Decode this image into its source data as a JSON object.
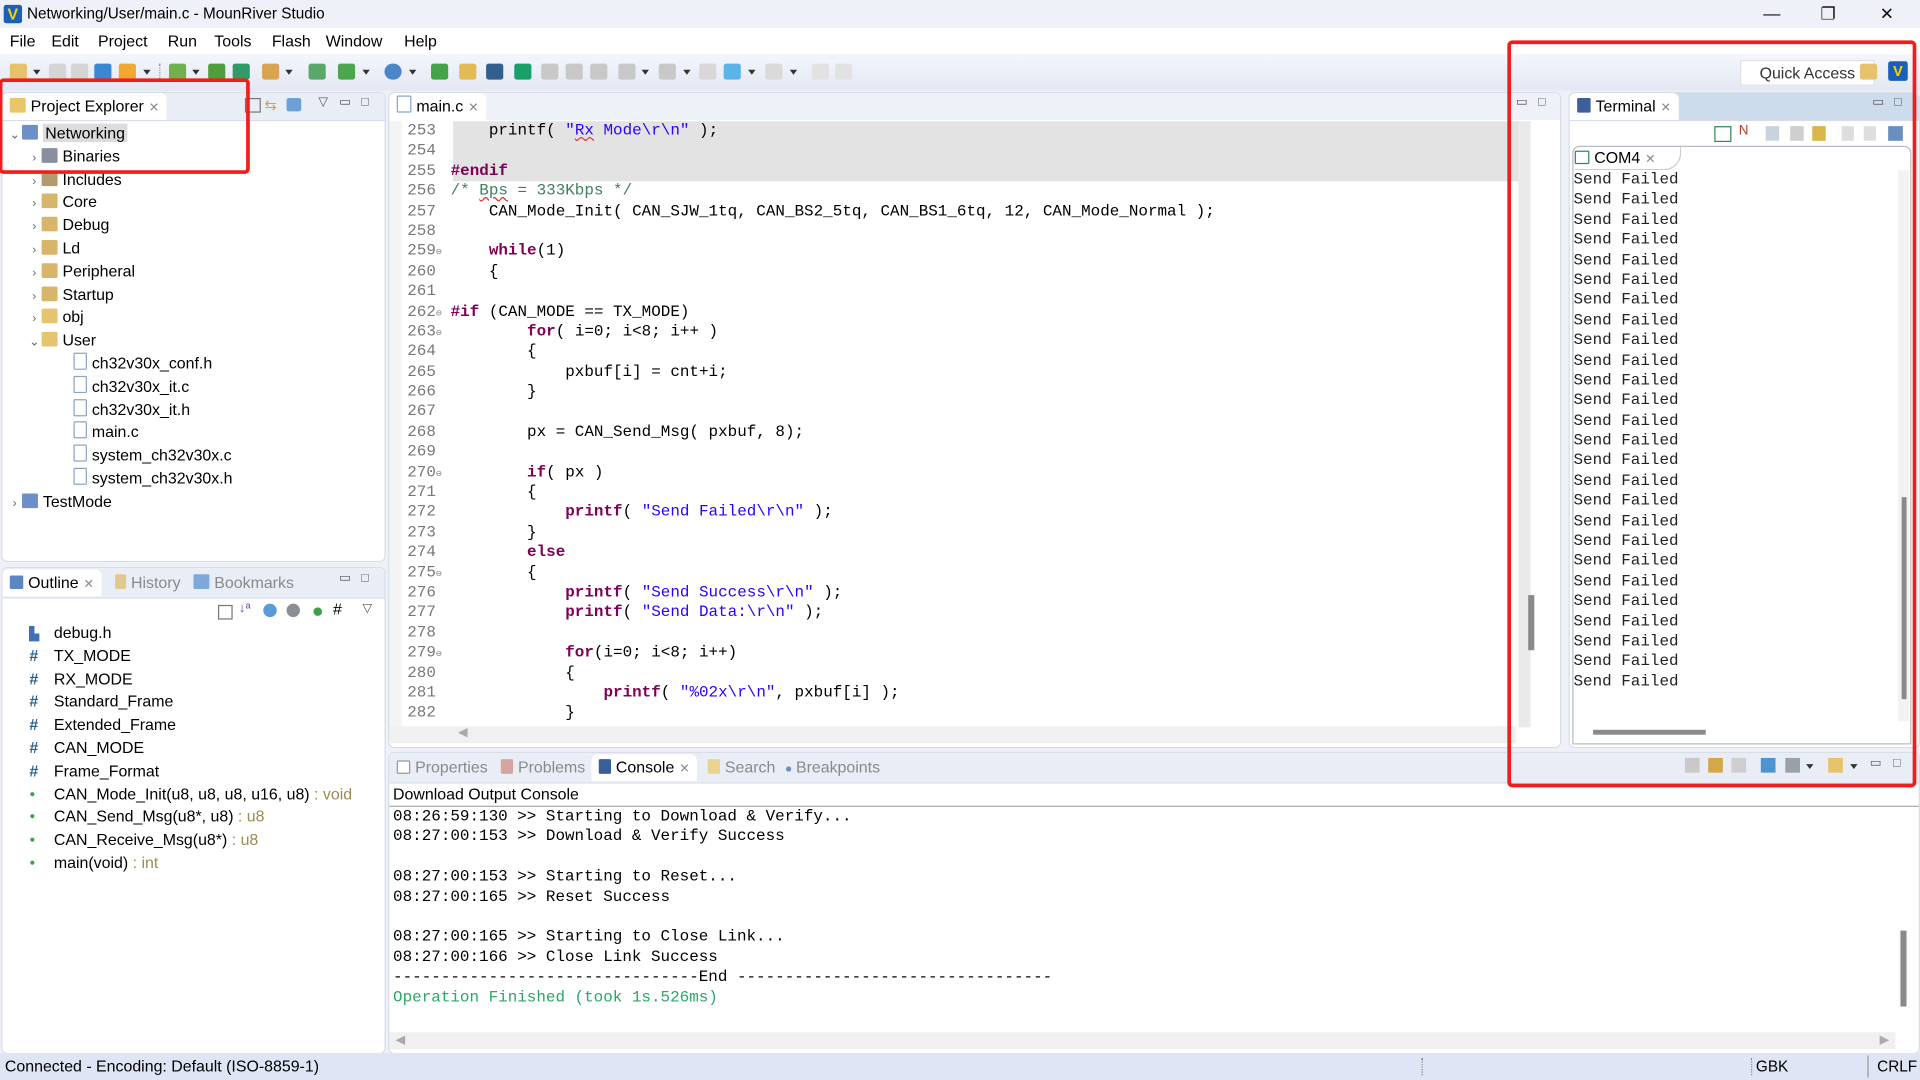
{
  "window": {
    "title": "Networking/User/main.c - MounRiver Studio",
    "controls": {
      "minimize": "—",
      "restore": "❐",
      "close": "✕"
    }
  },
  "menu": [
    "File",
    "Edit",
    "Project",
    "Run",
    "Tools",
    "Flash",
    "Window",
    "Help"
  ],
  "toolbar": {
    "quick_access": "Quick Access"
  },
  "project_explorer": {
    "tab_label": "Project Explorer",
    "tree": [
      {
        "label": "Networking",
        "level": 0,
        "expanded": true,
        "icon": "c-project-icon",
        "selected": true
      },
      {
        "label": "Binaries",
        "level": 1,
        "expanded": false,
        "icon": "binaries-icon"
      },
      {
        "label": "Includes",
        "level": 1,
        "expanded": false,
        "icon": "includes-icon"
      },
      {
        "label": "Core",
        "level": 1,
        "expanded": false,
        "icon": "source-folder-icon"
      },
      {
        "label": "Debug",
        "level": 1,
        "expanded": false,
        "icon": "source-folder-icon"
      },
      {
        "label": "Ld",
        "level": 1,
        "expanded": false,
        "icon": "source-folder-icon"
      },
      {
        "label": "Peripheral",
        "level": 1,
        "expanded": false,
        "icon": "source-folder-icon"
      },
      {
        "label": "Startup",
        "level": 1,
        "expanded": false,
        "icon": "source-folder-icon"
      },
      {
        "label": "obj",
        "level": 1,
        "expanded": false,
        "icon": "folder-icon"
      },
      {
        "label": "User",
        "level": 1,
        "expanded": true,
        "icon": "folder-icon"
      },
      {
        "label": "ch32v30x_conf.h",
        "level": 2,
        "icon": "header-file-icon"
      },
      {
        "label": "ch32v30x_it.c",
        "level": 2,
        "icon": "c-file-icon"
      },
      {
        "label": "ch32v30x_it.h",
        "level": 2,
        "icon": "header-file-icon"
      },
      {
        "label": "main.c",
        "level": 2,
        "icon": "c-file-icon"
      },
      {
        "label": "system_ch32v30x.c",
        "level": 2,
        "icon": "c-file-icon"
      },
      {
        "label": "system_ch32v30x.h",
        "level": 2,
        "icon": "header-file-icon"
      },
      {
        "label": "TestMode",
        "level": 0,
        "expanded": false,
        "icon": "c-project-icon"
      }
    ]
  },
  "outline": {
    "tabs": [
      {
        "label": "Outline",
        "active": true
      },
      {
        "label": "History",
        "active": false
      },
      {
        "label": "Bookmarks",
        "active": false
      }
    ],
    "items": [
      {
        "kind": "include",
        "name": "debug.h",
        "type": ""
      },
      {
        "kind": "macro",
        "name": "TX_MODE",
        "type": ""
      },
      {
        "kind": "macro",
        "name": "RX_MODE",
        "type": ""
      },
      {
        "kind": "macro",
        "name": "Standard_Frame",
        "type": ""
      },
      {
        "kind": "macro",
        "name": "Extended_Frame",
        "type": ""
      },
      {
        "kind": "macro",
        "name": "CAN_MODE",
        "type": ""
      },
      {
        "kind": "macro",
        "name": "Frame_Format",
        "type": ""
      },
      {
        "kind": "function",
        "name": "CAN_Mode_Init(u8, u8, u8, u16, u8)",
        "type": " : void"
      },
      {
        "kind": "function",
        "name": "CAN_Send_Msg(u8*, u8)",
        "type": " : u8"
      },
      {
        "kind": "function",
        "name": "CAN_Receive_Msg(u8*)",
        "type": " : u8"
      },
      {
        "kind": "function",
        "name": "main(void)",
        "type": " : int"
      }
    ]
  },
  "editor": {
    "tab_label": "main.c",
    "lines": [
      {
        "n": "253",
        "fold": "",
        "hl": true,
        "html": "    printf( <span class='str'>\"<span class='sq'>Rx</span> Mode\\r\\n\"</span> );"
      },
      {
        "n": "254",
        "fold": "",
        "hl": true,
        "html": ""
      },
      {
        "n": "255",
        "fold": "",
        "hl": true,
        "html": "<span class='kw'>#endif</span>"
      },
      {
        "n": "256",
        "fold": "",
        "hl": false,
        "html": "<span class='cm'>/* <span class='sq'>Bps</span> = 333Kbps */</span>"
      },
      {
        "n": "257",
        "fold": "",
        "hl": false,
        "html": "    CAN_Mode_Init( CAN_SJW_1tq, CAN_BS2_5tq, CAN_BS1_6tq, 12, CAN_Mode_Normal );"
      },
      {
        "n": "258",
        "fold": "",
        "hl": false,
        "html": ""
      },
      {
        "n": "259",
        "fold": "⊖",
        "hl": false,
        "html": "    <span class='kw'>while</span>(1)"
      },
      {
        "n": "260",
        "fold": "",
        "hl": false,
        "html": "    {"
      },
      {
        "n": "261",
        "fold": "",
        "hl": false,
        "html": ""
      },
      {
        "n": "262",
        "fold": "⊖",
        "hl": false,
        "html": "<span class='kw'>#if</span> (CAN_MODE == TX_MODE)"
      },
      {
        "n": "263",
        "fold": "⊖",
        "hl": false,
        "html": "        <span class='kw'>for</span>( i=0; i&lt;8; i++ )"
      },
      {
        "n": "264",
        "fold": "",
        "hl": false,
        "html": "        {"
      },
      {
        "n": "265",
        "fold": "",
        "hl": false,
        "html": "            pxbuf[i] = cnt+i;"
      },
      {
        "n": "266",
        "fold": "",
        "hl": false,
        "html": "        }"
      },
      {
        "n": "267",
        "fold": "",
        "hl": false,
        "html": ""
      },
      {
        "n": "268",
        "fold": "",
        "hl": false,
        "html": "        px = CAN_Send_Msg( pxbuf, 8);"
      },
      {
        "n": "269",
        "fold": "",
        "hl": false,
        "html": ""
      },
      {
        "n": "270",
        "fold": "⊖",
        "hl": false,
        "html": "        <span class='kw'>if</span>( px )"
      },
      {
        "n": "271",
        "fold": "",
        "hl": false,
        "html": "        {"
      },
      {
        "n": "272",
        "fold": "",
        "hl": false,
        "html": "            <span class='kw'>printf</span>( <span class='str'>\"Send Failed\\r\\n\"</span> );"
      },
      {
        "n": "273",
        "fold": "",
        "hl": false,
        "html": "        }"
      },
      {
        "n": "274",
        "fold": "",
        "hl": false,
        "html": "        <span class='kw'>else</span>"
      },
      {
        "n": "275",
        "fold": "⊖",
        "hl": false,
        "html": "        {"
      },
      {
        "n": "276",
        "fold": "",
        "hl": false,
        "html": "            <span class='kw'>printf</span>( <span class='str'>\"Send Success\\r\\n\"</span> );"
      },
      {
        "n": "277",
        "fold": "",
        "hl": false,
        "html": "            <span class='kw'>printf</span>( <span class='str'>\"Send Data:\\r\\n\"</span> );"
      },
      {
        "n": "278",
        "fold": "",
        "hl": false,
        "html": ""
      },
      {
        "n": "279",
        "fold": "⊖",
        "hl": false,
        "html": "            <span class='kw'>for</span>(i=0; i&lt;8; i++)"
      },
      {
        "n": "280",
        "fold": "",
        "hl": false,
        "html": "            {"
      },
      {
        "n": "281",
        "fold": "",
        "hl": false,
        "html": "                <span class='kw'>printf</span>( <span class='str'>\"%02x\\r\\n\"</span>, pxbuf[i] );"
      },
      {
        "n": "282",
        "fold": "",
        "hl": false,
        "html": "            }"
      }
    ]
  },
  "bottom_panel": {
    "tabs": [
      {
        "label": "Properties",
        "active": false
      },
      {
        "label": "Problems",
        "active": false
      },
      {
        "label": "Console",
        "active": true
      },
      {
        "label": "Search",
        "active": false
      },
      {
        "label": "Breakpoints",
        "active": false
      }
    ],
    "console_title": "Download Output Console",
    "lines": [
      {
        "text": "08:26:59:130 >> Starting to Download & Verify...",
        "color": "#000000"
      },
      {
        "text": "08:27:00:153 >> Download & Verify Success",
        "color": "#000000"
      },
      {
        "text": "",
        "color": "#000000"
      },
      {
        "text": "08:27:00:153 >> Starting to Reset...",
        "color": "#000000"
      },
      {
        "text": "08:27:00:165 >> Reset Success",
        "color": "#000000"
      },
      {
        "text": "",
        "color": "#000000"
      },
      {
        "text": "08:27:00:165 >> Starting to Close Link...",
        "color": "#000000"
      },
      {
        "text": "08:27:00:166 >> Close Link Success",
        "color": "#000000"
      },
      {
        "text": "--------------------------------End ---------------------------------",
        "color": "#000000"
      },
      {
        "text": "Operation Finished (took 1s.526ms)",
        "color": "#2aa764"
      }
    ]
  },
  "terminal": {
    "tab_label": "Terminal",
    "session_tab": "COM4",
    "lines": [
      "Send Failed",
      "Send Failed",
      "Send Failed",
      "Send Failed",
      "Send Failed",
      "Send Failed",
      "Send Failed",
      "Send Failed",
      "Send Failed",
      "Send Failed",
      "Send Failed",
      "Send Failed",
      "Send Failed",
      "Send Failed",
      "Send Failed",
      "Send Failed",
      "Send Failed",
      "Send Failed",
      "Send Failed",
      "Send Failed",
      "Send Failed",
      "Send Failed",
      "Send Failed",
      "Send Failed",
      "Send Failed",
      "Send Failed"
    ]
  },
  "status_bar": {
    "message": "Connected - Encoding: Default (ISO-8859-1)",
    "encoding": "GBK",
    "line_endings": "CRLF"
  },
  "colors": {
    "annotation_red": "#f21c1c",
    "keyword": "#7f0055",
    "string": "#2a00ff",
    "comment": "#3f7f5f",
    "console_success": "#2aa764"
  }
}
